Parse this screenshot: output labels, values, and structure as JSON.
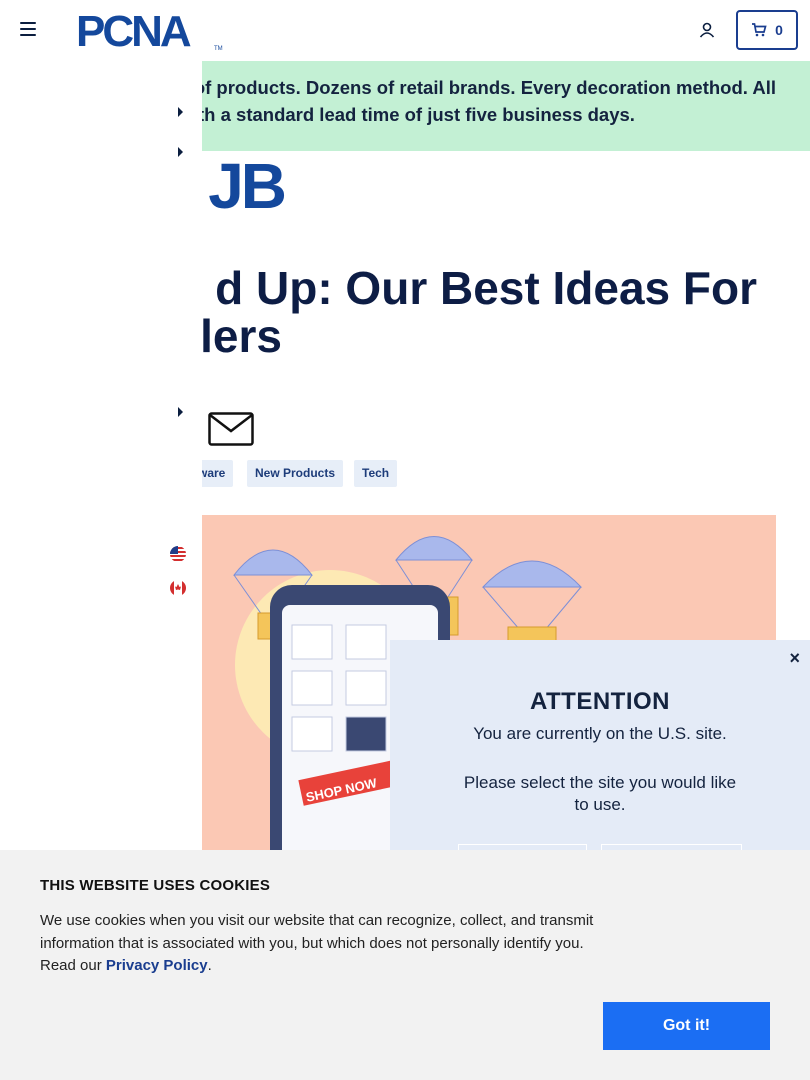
{
  "header": {
    "logo_text": "PCNA",
    "logo_tm": "TM",
    "cart_count": "0"
  },
  "banner": {
    "line1": "ls of products. Dozens of retail brands. Every decoration method. All",
    "line2": "th a standard lead time of just five business days."
  },
  "hub_logo_text": "JB",
  "article": {
    "title_line1": "d Up: Our Best Ideas For",
    "title_line2": "lers"
  },
  "tags": [
    "ware",
    "New Products",
    "Tech"
  ],
  "hero_image": {
    "shop_now": "SHOP NOW"
  },
  "side_menu": {
    "flags": [
      "us-flag-icon",
      "canada-flag-icon"
    ]
  },
  "modal": {
    "close": "×",
    "title": "ATTENTION",
    "line1": "You are currently on the U.S. site.",
    "line2": "Please select the site you would like to use."
  },
  "cookie": {
    "title": "THIS WEBSITE USES COOKIES",
    "text_before": "We use cookies when you visit our website that can recognize, collect, and transmit information that is associated with you, but which does not personally identify you. Read our ",
    "link": "Privacy Policy",
    "text_after": ".",
    "button": "Got it!"
  },
  "colors": {
    "brand": "#14489c",
    "banner_bg": "#c3f0d4",
    "modal_bg": "#e4ebf7",
    "cookie_bg": "#f2f2f2",
    "cta": "#1b6ef3"
  }
}
